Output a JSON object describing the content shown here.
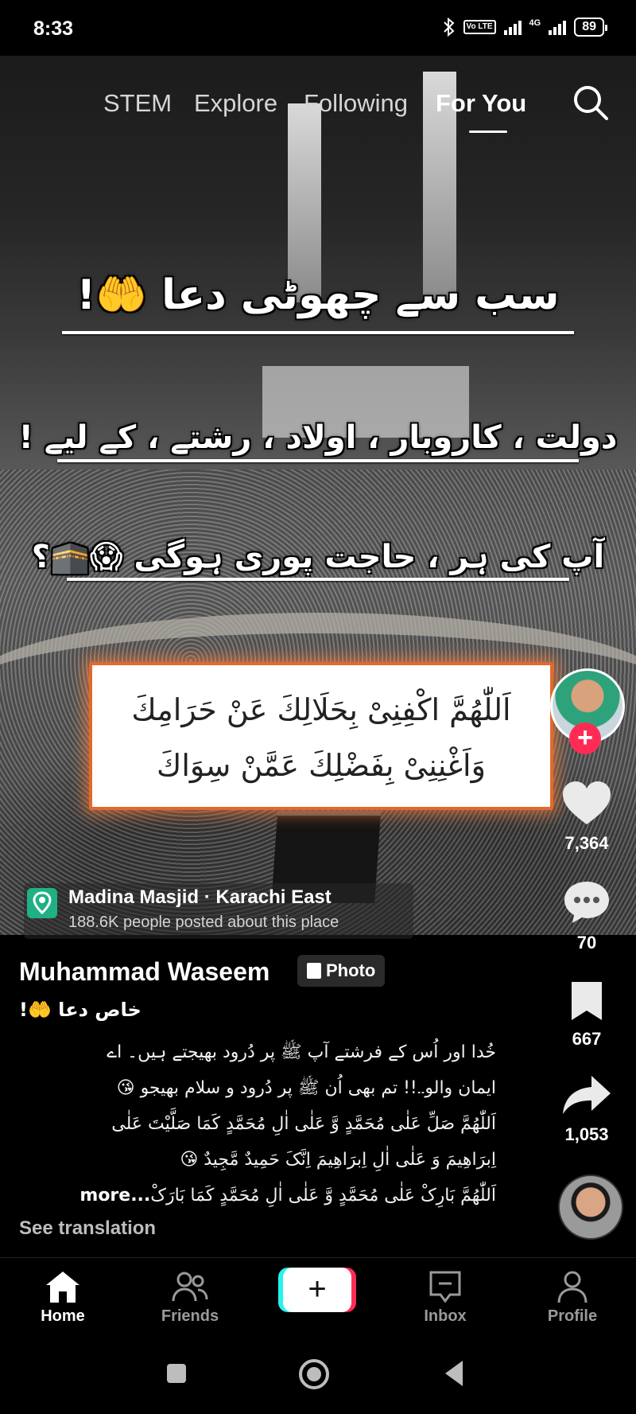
{
  "status_bar": {
    "time": "8:33",
    "volte": "Vo LTE",
    "network": "4G",
    "battery": "89"
  },
  "top_nav": {
    "tabs": [
      "STEM",
      "Explore",
      "Following",
      "For You"
    ],
    "active": "For You"
  },
  "video_overlay": {
    "caption_line1": "سب سے چھوٹی دعا 🤲!",
    "caption_line2": "دولت ، کاروبار ، اولاد ، رشتے ، کے لیے !",
    "caption_line3": "آپ کی ہر ، حاجت پوری ہوگی 😱🕋؟",
    "dua_line1": "اَللّٰھُمَّ اکْفِنِیْ بِحَلَالِكَ عَنْ حَرَامِكَ",
    "dua_line2": "وَاَغْنِنِیْ بِفَضْلِكَ عَمَّنْ سِوَاكَ"
  },
  "location": {
    "name": "Madina Masjid · Karachi East",
    "sub": "188.6K people posted about this place"
  },
  "actions": {
    "likes": "7,364",
    "comments": "70",
    "saves": "667",
    "shares": "1,053"
  },
  "post": {
    "author": "Muhammad Waseem",
    "type_badge": "Photo",
    "title": "خاص دعا 🤲!",
    "body_lines": [
      "خُدا اور اُس کے فرشتے آپ ﷺ پر دُرود بھیجتے ہیں۔ اے",
      "ایمان والو۔۔!! تم بھی اُن ﷺ پر دُرود و سلام بھیجو 😘",
      "اَللّٰھُمَّ صَلِّ عَلٰی مُحَمَّدٍ وَّ عَلٰی اٰلِ مُحَمَّدٍ کَمَا صَلَّیْتَ عَلٰی",
      "اِبرَاھِیمَ وَ عَلٰی اٰلِ اِبرَاھِیمَ اِنَّکَ حَمِیدٌ مَّجِیدٌ 😘",
      "اَللّٰھُمَّ بَارِکْ عَلٰی مُحَمَّدٍ وَّ عَلٰی اٰلِ مُحَمَّدٍ کَمَا بَارَکْ"
    ],
    "more": "...more",
    "see_translation": "See translation"
  },
  "bottom_nav": {
    "home": "Home",
    "friends": "Friends",
    "inbox": "Inbox",
    "profile": "Profile",
    "create": "+"
  },
  "colors": {
    "accent_red": "#fe2c55",
    "accent_cyan": "#25f4ee",
    "location_green": "#1fb184",
    "dua_border": "#e06a2c"
  },
  "icons": [
    "search-icon",
    "heart-icon",
    "comment-icon",
    "bookmark-icon",
    "share-icon",
    "home-icon",
    "friends-icon",
    "inbox-icon",
    "profile-icon",
    "location-pin-icon",
    "photo-icon",
    "bluetooth-icon"
  ]
}
